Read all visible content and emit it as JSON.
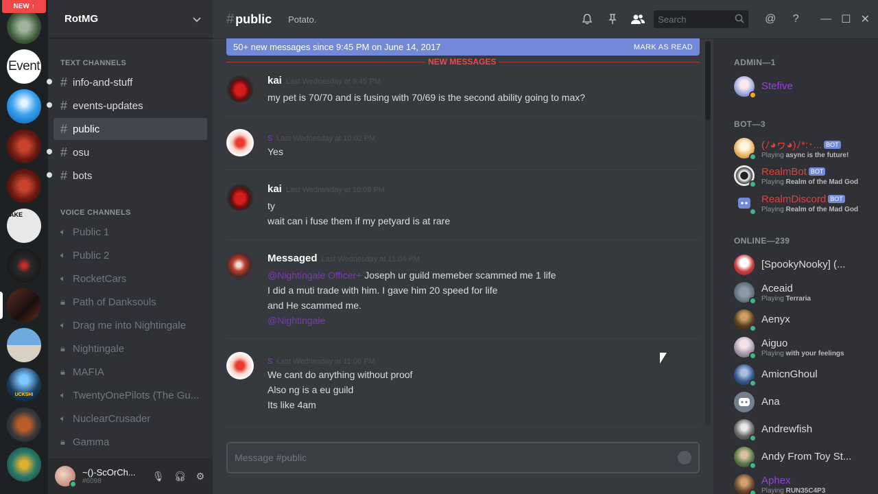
{
  "new_badge": "NEW ↑",
  "servers": [
    {
      "name": "RotMG",
      "label": ""
    },
    {
      "name": "Event",
      "label": "Event"
    },
    {
      "name": "server-3",
      "label": ""
    },
    {
      "name": "server-4",
      "label": ""
    },
    {
      "name": "server-5",
      "label": ""
    },
    {
      "name": "server-6",
      "label": "AKE"
    },
    {
      "name": "server-7",
      "label": ""
    },
    {
      "name": "server-8",
      "label": ""
    },
    {
      "name": "server-9",
      "label": ""
    },
    {
      "name": "server-10",
      "label": "UCKSHI"
    },
    {
      "name": "server-11",
      "label": ""
    },
    {
      "name": "server-12",
      "label": ""
    }
  ],
  "guild": {
    "name": "RotMG",
    "text_category": "TEXT CHANNELS",
    "voice_category": "VOICE CHANNELS",
    "text_channels": [
      "info-and-stuff",
      "events-updates",
      "public",
      "osu",
      "bots"
    ],
    "voice_channels": [
      "Public 1",
      "Public 2",
      "RocketCars",
      "Path of Danksouls",
      "Drag me into Nightingale",
      "Nightingale",
      "MAFIA",
      "TwentyOnePilots (The Gu...",
      "NuclearCrusader",
      "Gamma"
    ]
  },
  "user": {
    "name": "~()-ScOrCh...",
    "tag": "#6098"
  },
  "header": {
    "channel": "public",
    "topic": "Potato.",
    "search_placeholder": "Search"
  },
  "new_messages_bar": {
    "text": "50+ new messages since 9:45 PM on June 14, 2017",
    "action": "MARK AS READ",
    "divider": "NEW MESSAGES"
  },
  "messages": [
    {
      "author": "kai",
      "ts": "Last Wednesday at 9:45 PM",
      "lines": [
        "my pet is 70/70 and is fusing with 70/69 is the second ability going to max?"
      ]
    },
    {
      "author": "S",
      "ts": "Last Wednesday at 10:02 PM",
      "lines": [
        "Yes"
      ]
    },
    {
      "author": "kai",
      "ts": "Last Wednesday at 10:09 PM",
      "lines": [
        "ty",
        "wait can i fuse them if my petyard is at rare"
      ]
    },
    {
      "author": "Messaged",
      "ts": "Last Wednesday at 11:04 PM",
      "mention1": "@Nightingale Officer+",
      "lines": [
        " Joseph ur guild memeber scammed me 1 life",
        "I did a muti trade with him. I gave him 20 speed for life",
        "and He scammed me."
      ],
      "mention2": "@Nightingale"
    },
    {
      "author": "S",
      "ts": "Last Wednesday at 11:06 PM",
      "lines": [
        "We cant do anything without proof",
        "Also ng is a eu guild",
        "Its like 4am"
      ]
    }
  ],
  "composer": {
    "placeholder": "Message #public"
  },
  "members": {
    "admin_cat": "ADMIN—1",
    "bot_cat": "BOT—3",
    "online_cat": "ONLINE—239",
    "admin": [
      {
        "name": "Stefive"
      }
    ],
    "bots": [
      {
        "name": "(ﾉ◕ヮ◕)ﾉ*:･...",
        "playing": "async is the future!",
        "badge": "BOT"
      },
      {
        "name": "RealmBot",
        "playing": "Realm of the Mad God",
        "badge": "BOT"
      },
      {
        "name": "RealmDiscord",
        "playing": "Realm of the Mad God",
        "badge": "BOT"
      }
    ],
    "online": [
      {
        "name": "[SpookyNooky] (...",
        "playing": ""
      },
      {
        "name": "Aceaid",
        "playing": "Terraria"
      },
      {
        "name": "Aenyx",
        "playing": ""
      },
      {
        "name": "Aiguo",
        "playing": "with your feelings"
      },
      {
        "name": "AmicnGhoul",
        "playing": ""
      },
      {
        "name": "Ana",
        "playing": ""
      },
      {
        "name": "Andrewfish",
        "playing": ""
      },
      {
        "name": "Andy From Toy St...",
        "playing": ""
      },
      {
        "name": "Aphex",
        "playing": "RUN35C4P3"
      }
    ],
    "playing_prefix": "Playing"
  },
  "colors": {
    "accent": "#7289da",
    "new_red": "#f04747",
    "online": "#43b581"
  }
}
